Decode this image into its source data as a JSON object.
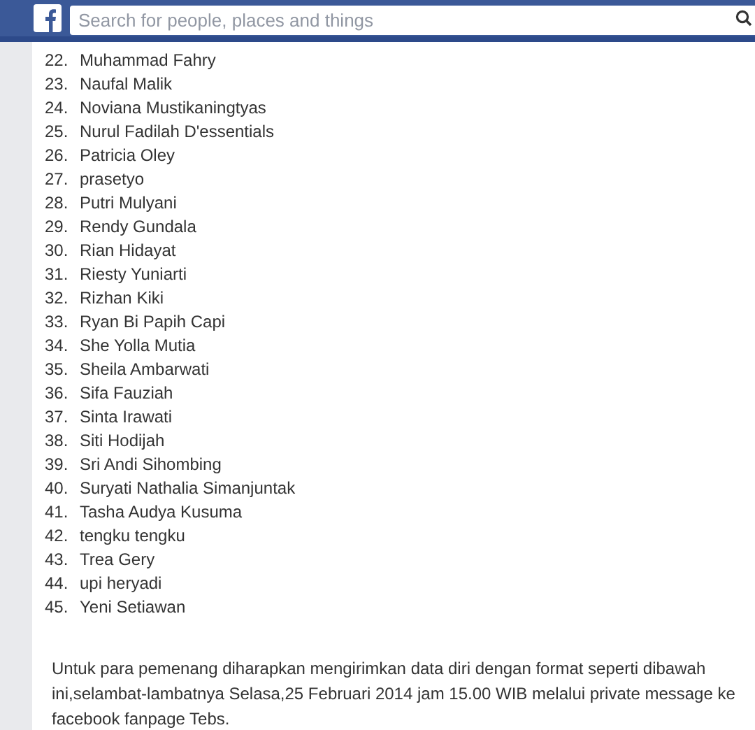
{
  "search": {
    "placeholder": "Search for people, places and things"
  },
  "winners": [
    {
      "number": "22.",
      "name": "Muhammad Fahry"
    },
    {
      "number": "23.",
      "name": "Naufal Malik"
    },
    {
      "number": "24.",
      "name": "Noviana Mustikaningtyas"
    },
    {
      "number": "25.",
      "name": "Nurul Fadilah D'essentials"
    },
    {
      "number": "26.",
      "name": "Patricia Oley"
    },
    {
      "number": "27.",
      "name": "prasetyo"
    },
    {
      "number": "28.",
      "name": "Putri Mulyani"
    },
    {
      "number": "29.",
      "name": "Rendy Gundala"
    },
    {
      "number": "30.",
      "name": "Rian Hidayat"
    },
    {
      "number": "31.",
      "name": "Riesty Yuniarti"
    },
    {
      "number": "32.",
      "name": "Rizhan Kiki"
    },
    {
      "number": "33.",
      "name": "Ryan Bi Papih Capi"
    },
    {
      "number": "34.",
      "name": "She Yolla Mutia"
    },
    {
      "number": "35.",
      "name": "Sheila Ambarwati"
    },
    {
      "number": "36.",
      "name": "Sifa Fauziah"
    },
    {
      "number": "37.",
      "name": "Sinta Irawati"
    },
    {
      "number": "38.",
      "name": "Siti Hodijah"
    },
    {
      "number": "39.",
      "name": "Sri Andi Sihombing"
    },
    {
      "number": "40.",
      "name": "Suryati Nathalia Simanjuntak"
    },
    {
      "number": "41.",
      "name": "Tasha Audya Kusuma"
    },
    {
      "number": "42.",
      "name": "tengku tengku"
    },
    {
      "number": "43.",
      "name": "Trea Gery"
    },
    {
      "number": "44.",
      "name": "upi heryadi"
    },
    {
      "number": "45.",
      "name": "Yeni Setiawan"
    }
  ],
  "paragraph": "Untuk para pemenang diharapkan mengirimkan data diri dengan format seperti dibawah ini,selambat-lambatnya Selasa,25 Februari 2014 jam 15.00 WIB melalui private message ke facebook fanpage Tebs."
}
